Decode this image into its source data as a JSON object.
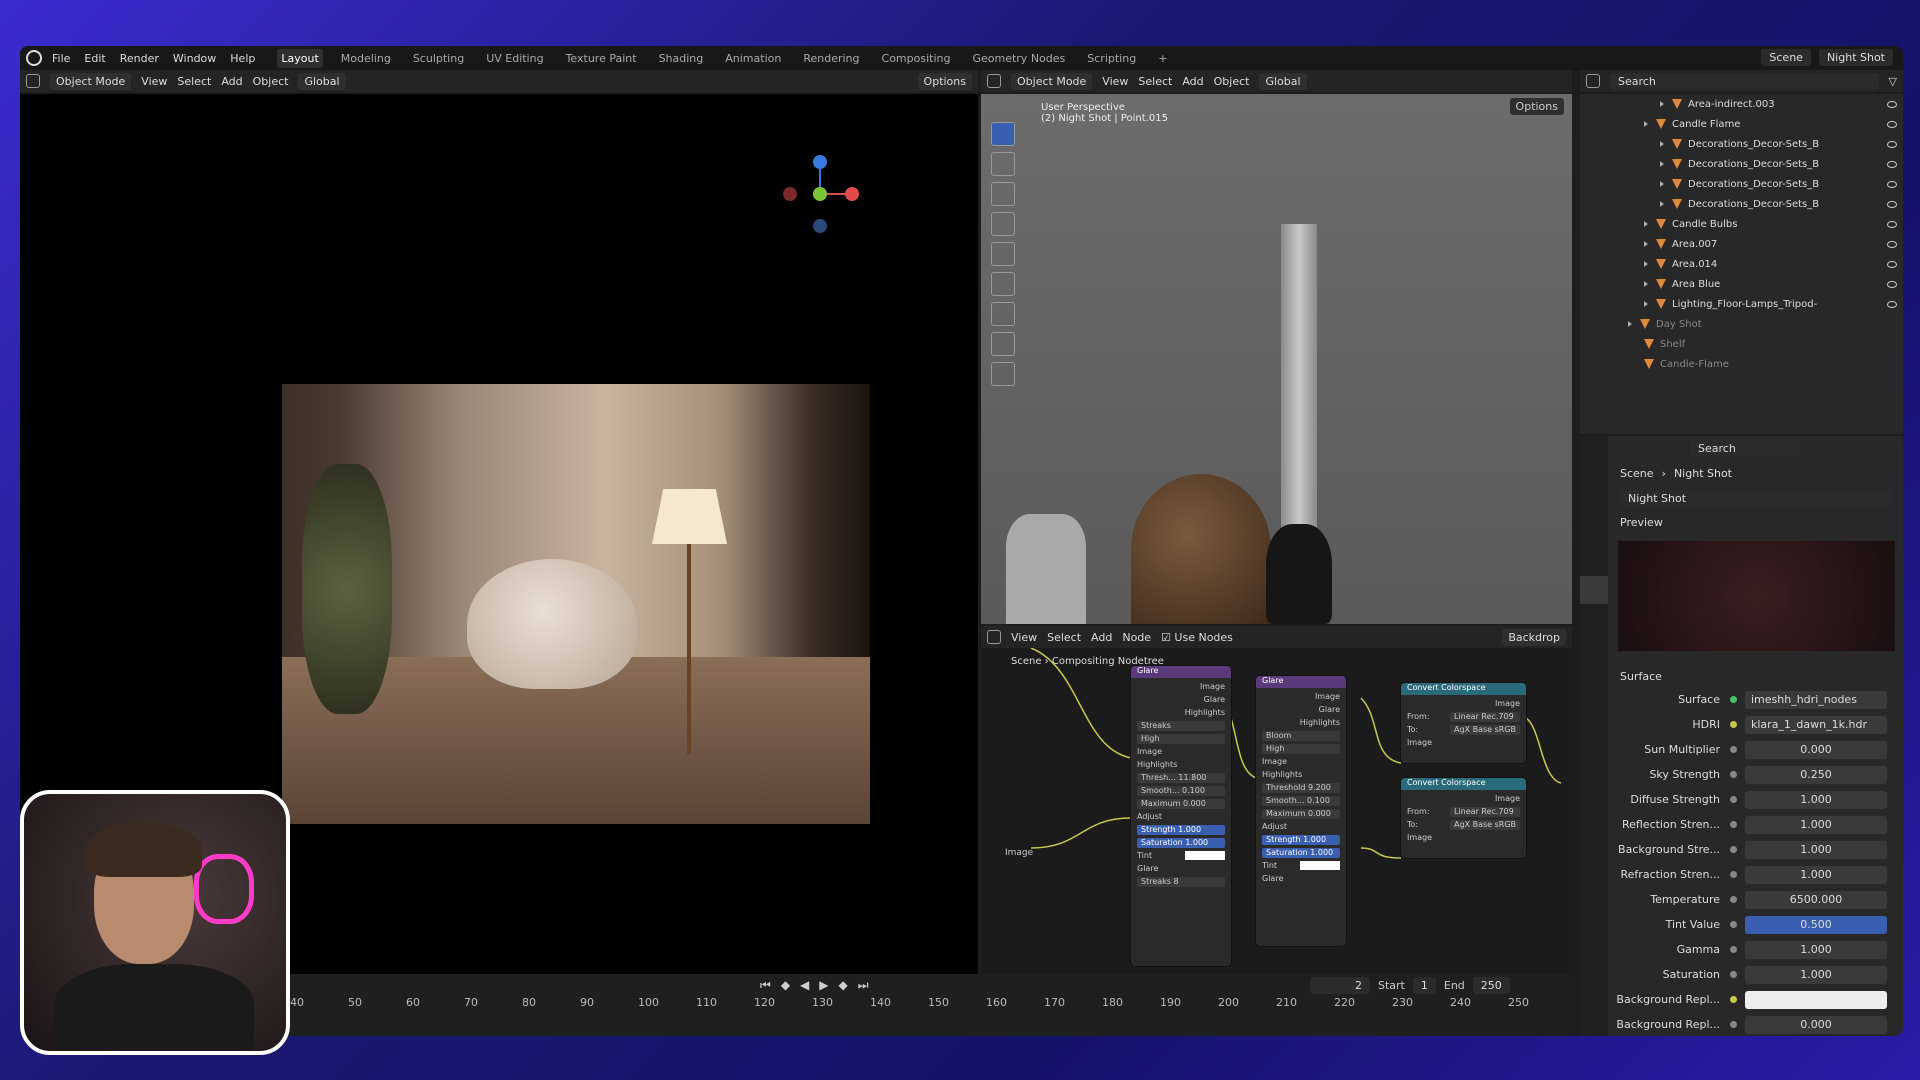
{
  "menu": [
    "File",
    "Edit",
    "Render",
    "Window",
    "Help"
  ],
  "workspaces": [
    "Layout",
    "Modeling",
    "Sculpting",
    "UV Editing",
    "Texture Paint",
    "Shading",
    "Animation",
    "Rendering",
    "Compositing",
    "Geometry Nodes",
    "Scripting"
  ],
  "scene": "Scene",
  "view_layer": "Night Shot",
  "vp_left": {
    "mode": "Object Mode",
    "menus": [
      "View",
      "Select",
      "Add",
      "Object"
    ],
    "transform": "Global",
    "options": "Options"
  },
  "vp_right": {
    "mode": "Object Mode",
    "menus": [
      "View",
      "Select",
      "Add",
      "Object"
    ],
    "transform": "Global",
    "options": "Options",
    "overlay1": "User Perspective",
    "overlay2": "(2) Night Shot | Point.015"
  },
  "node_editor": {
    "menus": [
      "View",
      "Select",
      "Add",
      "Node"
    ],
    "use_nodes": "Use Nodes",
    "backdrop": "Backdrop",
    "breadcrumb1": "Scene",
    "breadcrumb2": "Compositing Nodetree"
  },
  "nodes": {
    "glare1": {
      "title": "Glare",
      "out": [
        "Image",
        "Glare",
        "Highlights"
      ],
      "type": "Streaks",
      "quality": "High",
      "in_image": "Image",
      "sec_high": "Highlights",
      "thresh": "Thresh... 11.800",
      "smooth": "Smooth... 0.100",
      "max": "Maximum 0.000",
      "sec_adj": "Adjust",
      "strength": "Strength 1.000",
      "saturation": "Saturation 1.000",
      "tint": "Tint",
      "sec_glare": "Glare",
      "streaks": "Streaks 8"
    },
    "glare2": {
      "title": "Glare",
      "out": [
        "Image",
        "Glare",
        "Highlights"
      ],
      "type": "Bloom",
      "quality": "High",
      "in_image": "Image",
      "sec_high": "Highlights",
      "thresh": "Threshold 9.200",
      "smooth": "Smooth... 0.100",
      "max": "Maximum 0.000",
      "sec_adj": "Adjust",
      "strength": "Strength 1.000",
      "saturation": "Saturation 1.000",
      "tint": "Tint",
      "sec_glare": "Glare"
    },
    "cc1": {
      "title": "Convert Colorspace",
      "out": "Image",
      "from_l": "From:",
      "from": "Linear Rec.709",
      "to_l": "To:",
      "to": "AgX Base sRGB",
      "in": "Image"
    },
    "cc2": {
      "title": "Convert Colorspace",
      "out": "Image",
      "from_l": "From:",
      "from": "Linear Rec.709",
      "to_l": "To:",
      "to": "AgX Base sRGB",
      "in": "Image"
    },
    "image_label": "Image"
  },
  "timeline": {
    "ticks": [
      "40",
      "50",
      "60",
      "70",
      "80",
      "90",
      "100",
      "110",
      "120",
      "130",
      "140",
      "150",
      "160",
      "170",
      "180",
      "190",
      "200",
      "210",
      "220",
      "230",
      "240",
      "250"
    ],
    "current": "2",
    "start_l": "Start",
    "start": "1",
    "end_l": "End",
    "end": "250"
  },
  "outliner": {
    "search": "Search",
    "rows": [
      "Area-indirect.003",
      "Candle Flame",
      "Decorations_Decor-Sets_B",
      "Decorations_Decor-Sets_B",
      "Decorations_Decor-Sets_B",
      "Decorations_Decor-Sets_B",
      "Candle Bulbs",
      "Area.007",
      "Area.014",
      "Area Blue",
      "Lighting_Floor-Lamps_Tripod-",
      "Day Shot",
      "Shelf",
      "Candle-Flame"
    ]
  },
  "properties": {
    "search": "Search",
    "bc1": "Scene",
    "bc2": "Night Shot",
    "world": "Night Shot",
    "preview": "Preview",
    "surface_sec": "Surface",
    "surface_l": "Surface",
    "surface": "imeshh_hdri_nodes",
    "hdri_l": "HDRI",
    "hdri": "klara_1_dawn_1k.hdr",
    "rows": [
      [
        "Sun Multiplier",
        "0.000"
      ],
      [
        "Sky Strength",
        "0.250"
      ],
      [
        "Diffuse Strength",
        "1.000"
      ],
      [
        "Reflection Stren...",
        "1.000"
      ],
      [
        "Background Stre...",
        "1.000"
      ],
      [
        "Refraction Stren...",
        "1.000"
      ],
      [
        "Temperature",
        "6500.000"
      ],
      [
        "Tint Value",
        "0.500"
      ],
      [
        "Gamma",
        "1.000"
      ],
      [
        "Saturation",
        "1.000"
      ],
      [
        "Background Repl...",
        ""
      ],
      [
        "Background Repl...",
        "0.000"
      ]
    ]
  }
}
